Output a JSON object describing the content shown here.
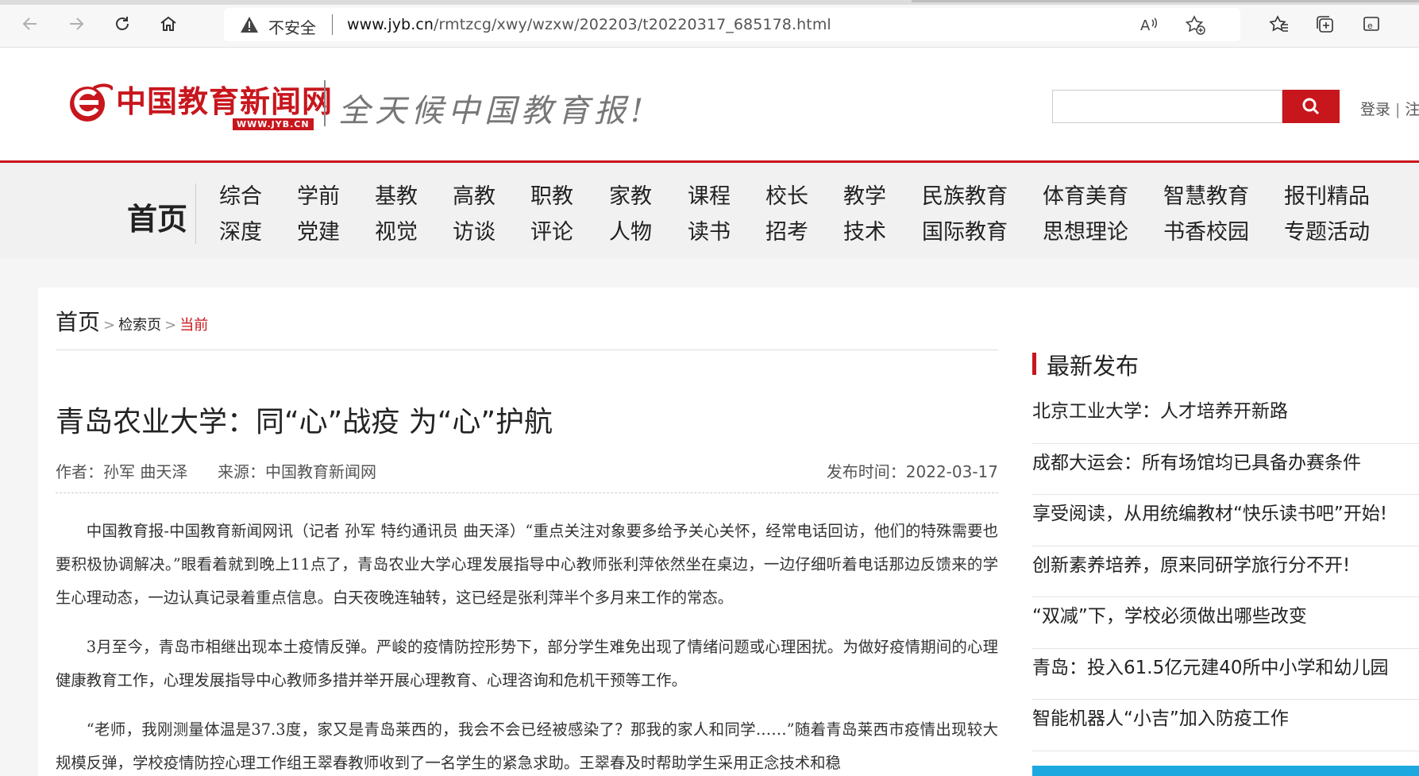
{
  "browser": {
    "insecure_label": "不安全",
    "url_host": "www.jyb.cn",
    "url_path": "/rmtzcg/xwy/wzxw/202203/t20220317_685178.html",
    "icons": [
      "back-arrow-icon",
      "forward-arrow-icon",
      "refresh-icon",
      "home-icon",
      "warning-icon",
      "read-aloud-icon",
      "add-favorite-icon",
      "favorites-icon",
      "collections-icon",
      "ie-mode-icon"
    ]
  },
  "header": {
    "logo_name": "中国教育新闻网",
    "logo_domain": "WWW.JYB.CN",
    "slogan": "全天候中国教育报!",
    "search_placeholder": "",
    "login": "登录",
    "login_sep": "|",
    "register": "注"
  },
  "nav": {
    "home": "首页",
    "columns": [
      [
        "综合",
        "深度"
      ],
      [
        "学前",
        "党建"
      ],
      [
        "基教",
        "视觉"
      ],
      [
        "高教",
        "访谈"
      ],
      [
        "职教",
        "评论"
      ],
      [
        "家教",
        "人物"
      ],
      [
        "课程",
        "读书"
      ],
      [
        "校长",
        "招考"
      ],
      [
        "教学",
        "技术"
      ],
      [
        "民族教育",
        "国际教育"
      ],
      [
        "体育美育",
        "思想理论"
      ],
      [
        "智慧教育",
        "书香校园"
      ],
      [
        "报刊精品",
        "专题活动"
      ]
    ]
  },
  "breadcrumb": {
    "home": "首页",
    "arrow": ">",
    "search": "检索页",
    "current": "当前"
  },
  "article": {
    "title": "青岛农业大学：同“心”战疫 为“心”护航",
    "author": "作者：孙军 曲天泽",
    "source": "来源：中国教育新闻网",
    "date": "发布时间：2022-03-17",
    "paragraphs": [
      "中国教育报-中国教育新闻网讯（记者 孙军 特约通讯员 曲天泽）“重点关注对象要多给予关心关怀，经常电话回访，他们的特殊需要也要积极协调解决。”眼看着就到晚上11点了，青岛农业大学心理发展指导中心教师张利萍依然坐在桌边，一边仔细听着电话那边反馈来的学生心理动态，一边认真记录着重点信息。白天夜晚连轴转，这已经是张利萍半个多月来工作的常态。",
      "3月至今，青岛市相继出现本土疫情反弹。严峻的疫情防控形势下，部分学生难免出现了情绪问题或心理困扰。为做好疫情期间的心理健康教育工作，心理发展指导中心教师多措并举开展心理教育、心理咨询和危机干预等工作。",
      "“老师，我刚测量体温是37.3度，家又是青岛莱西的，我会不会已经被感染了？那我的家人和同学……”随着青岛莱西市疫情出现较大规模反弹，学校疫情防控心理工作组王翠春教师收到了一名学生的紧急求助。王翠春及时帮助学生采用正念技术和稳"
    ]
  },
  "sidebar": {
    "title": "最新发布",
    "items": [
      "北京工业大学：人才培养开新路",
      "成都大运会：所有场馆均已具备办赛条件",
      "享受阅读，从用统编教材“快乐读书吧”开始!",
      "创新素养培养，原来同研学旅行分不开!",
      "“双减”下，学校必须做出哪些改变",
      "青岛：投入61.5亿元建40所中小学和幼儿园",
      "智能机器人“小吉”加入防疫工作"
    ]
  },
  "colors": {
    "brand_red": "#c8161d",
    "accent_blue": "#1da8e0"
  }
}
